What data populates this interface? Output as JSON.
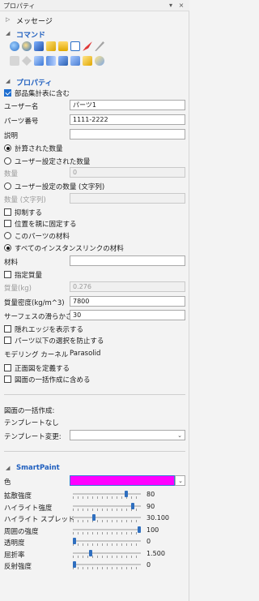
{
  "panel": {
    "title": "プロパティ",
    "pin_glyph": "▾",
    "close_glyph": "×"
  },
  "sections": {
    "message": "メッセージ",
    "command": "コマンド",
    "properties": "プロパティ",
    "smartpaint": "SmartPaint"
  },
  "command_icons": {
    "row1": [
      "globe-icon",
      "globe-edit-icon",
      "box-icon",
      "layers-icon",
      "folder-open-icon",
      "window-icon",
      "tool-red-icon",
      "wand-icon"
    ],
    "row2": [
      "move-gray-icon",
      "pin-gray-icon",
      "sqrt-icon",
      "link-icon",
      "box-link-icon",
      "shape-icon",
      "cube-icon",
      "spark-icon"
    ]
  },
  "props": {
    "include_in_bom": "部品集計表に含む",
    "user_name_label": "ユーザー名",
    "user_name_value": "パーツ1",
    "part_number_label": "パーツ番号",
    "part_number_value": "1111-2222",
    "description_label": "説明",
    "description_value": "",
    "calc_qty": "計算された数量",
    "user_qty": "ユーザー設定された数量",
    "qty_label": "数量",
    "qty_value": "0",
    "user_qty_string": "ユーザー設定の数量 (文字列)",
    "qty_string_label": "数量 (文字列)",
    "qty_string_value": "",
    "suppress": "抑制する",
    "fix_to_parent": "位置を親に固定する",
    "this_part_material": "このパーツの材料",
    "all_instance_material": "すべてのインスタンスリンクの材料",
    "material_label": "材料",
    "material_value": "",
    "specify_mass": "指定質量",
    "mass_label": "質量(kg)",
    "mass_value": "0.276",
    "density_label": "質量密度(kg/m^3)",
    "density_value": "7800",
    "smoothness_label": "サーフェスの滑らかさ",
    "smoothness_value": "30",
    "show_hidden_edges": "隠れエッジを表示する",
    "prevent_selection_below": "パーツ以下の選択を防止する",
    "modeling_kernel_label": "モデリング カーネル",
    "modeling_kernel_value": "Parasolid",
    "define_front_view": "正面図を定義する",
    "include_in_batch_drawing": "図面の一括作成に含める"
  },
  "batch": {
    "batch_label": "図面の一括作成:",
    "no_template": "テンプレートなし",
    "template_change_label": "テンプレート変更:",
    "template_value": ""
  },
  "smartpaint": {
    "color_label": "色",
    "color_hex": "#ff00ff",
    "sliders": [
      {
        "label": "拡散強度",
        "value": "80",
        "fraction": 0.8
      },
      {
        "label": "ハイライト強度",
        "value": "90",
        "fraction": 0.9
      },
      {
        "label": "ハイライト スプレッド",
        "value": "30.100",
        "fraction": 0.3
      },
      {
        "label": "周囲の強度",
        "value": "100",
        "fraction": 1.0
      },
      {
        "label": "透明度",
        "value": "0",
        "fraction": 0.0
      },
      {
        "label": "屈折率",
        "value": "1.500",
        "fraction": 0.25
      },
      {
        "label": "反射強度",
        "value": "0",
        "fraction": 0.0
      }
    ]
  }
}
